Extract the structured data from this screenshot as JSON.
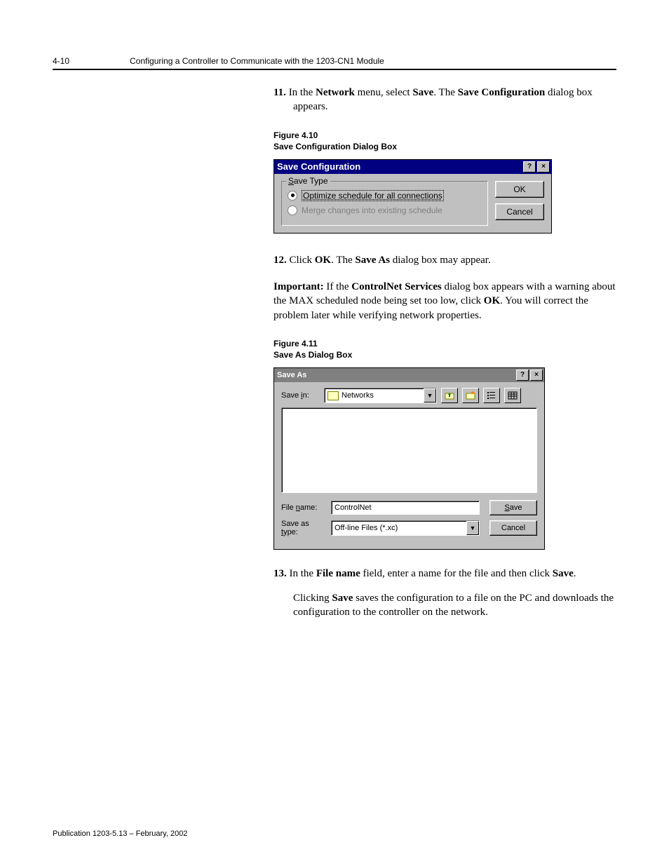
{
  "header": {
    "page_number": "4-10",
    "title": "Configuring a Controller to Communicate with the 1203-CN1 Module"
  },
  "step11": {
    "num": "11.",
    "t1": "In the ",
    "b1": "Network",
    "t2": " menu, select ",
    "b2": "Save",
    "t3": ". The ",
    "b3": "Save Configuration",
    "t4": " dialog box appears."
  },
  "fig410": {
    "num": "Figure 4.10",
    "title": "Save Configuration Dialog Box"
  },
  "dlg1": {
    "title": "Save Configuration",
    "help": "?",
    "close": "×",
    "group_label": "Save Type",
    "radio1": "Optimize schedule for all connections",
    "radio2": "Merge changes into existing schedule",
    "ok": "OK",
    "cancel": "Cancel"
  },
  "step12": {
    "num": "12.",
    "t1": "Click ",
    "b1": "OK",
    "t2": ". The ",
    "b2": "Save As",
    "t3": " dialog box may appear."
  },
  "important": {
    "b0": "Important:",
    "t1": " If the ",
    "b1": "ControlNet Services",
    "t2": " dialog box appears with a warning about the MAX scheduled node being set too low, click ",
    "b2": "OK",
    "t3": ". You will correct the problem later while verifying network properties."
  },
  "fig411": {
    "num": "Figure 4.11",
    "title": "Save As Dialog Box"
  },
  "dlg2": {
    "title": "Save As",
    "help": "?",
    "close": "×",
    "save_in_label": "Save in:",
    "save_in_value": "Networks",
    "file_name_label_pre": "File ",
    "file_name_label_u": "n",
    "file_name_label_post": "ame:",
    "file_name_value": "ControlNet",
    "save_type_label_pre": "Save as ",
    "save_type_label_u": "t",
    "save_type_label_post": "ype:",
    "save_type_value": "Off-line Files (*.xc)",
    "save_btn_u": "S",
    "save_btn_post": "ave",
    "cancel_btn": "Cancel"
  },
  "step13": {
    "num": "13.",
    "t1": "In the ",
    "b1": "File name",
    "t2": " field, enter a name for the file and then click ",
    "b2": "Save",
    "t3": "."
  },
  "step13b": {
    "t1": "Clicking ",
    "b1": "Save",
    "t2": " saves the configuration to a file on the PC and downloads the configuration to the controller on the network."
  },
  "footer": "Publication 1203-5.13 – February, 2002"
}
